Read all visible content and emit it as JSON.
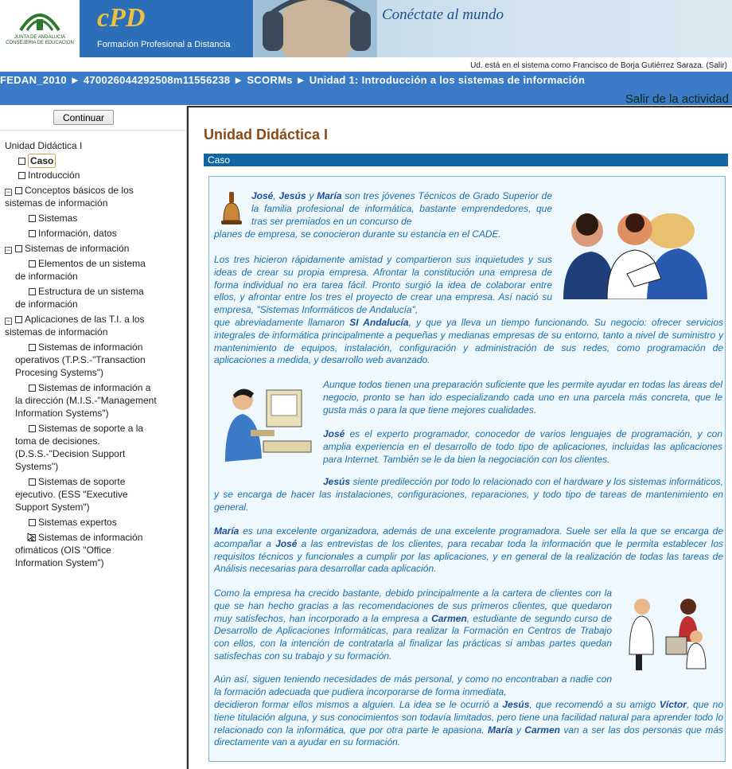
{
  "header": {
    "junta_text": "JUNTA DE ANDALUCIA\nCONSEJERIA DE EDUCACION",
    "cpd_logo": "cPD",
    "cpd_subtitle": "Formación Profesional a Distancia",
    "slogan": "Conéctate al mundo"
  },
  "user_line": {
    "prefix": "Ud. está en el sistema como",
    "user": "Francisco de Borja Gutiérrez Saraza.",
    "logout": "(Salir)"
  },
  "breadcrumb": {
    "items": [
      "FEDAN_2010",
      "470026044292508m11556238",
      "SCORMs",
      "Unidad 1: Introducción a los sistemas de información"
    ],
    "separator": "►"
  },
  "exit_link": "Salir de la actividad",
  "sidebar": {
    "continue_button": "Continuar",
    "root": "Unidad Didáctica I",
    "items": [
      {
        "label": "Caso"
      },
      {
        "label": "Introducción"
      },
      {
        "label": "Conceptos básicos de los",
        "label2": "sistemas de información"
      },
      {
        "label": "Sistemas"
      },
      {
        "label": "Información, datos"
      },
      {
        "label": "Sistemas de información"
      },
      {
        "label": "Elementos de un sistema",
        "label2": "de información"
      },
      {
        "label": "Estructura de un sistema",
        "label2": "de información"
      },
      {
        "label": "Aplicaciones de las T.I. a los",
        "label2": "sistemas de información"
      },
      {
        "label": "Sistemas de información",
        "label2": "operativos (T.P.S.-\"Transaction",
        "label3": "Procesing Systems\")"
      },
      {
        "label": "Sistemas de información a",
        "label2": "la dirección (M.I.S.-\"Management",
        "label3": "Information Systems\")"
      },
      {
        "label": "Sistemas de soporte a la",
        "label2": "toma de decisiones.",
        "label3": "(D.S.S.-\"Decision Support",
        "label4": "Systems\")"
      },
      {
        "label": "Sistemas de soporte",
        "label2": "ejecutivo. (ESS \"Executive",
        "label3": "Support System\")"
      },
      {
        "label": "Sistemas expertos"
      },
      {
        "label": "Sistemas de información",
        "label2": "ofimáticos (OIS \"Office",
        "label3": "Information System\")"
      }
    ]
  },
  "main": {
    "title": "Unidad Didáctica I",
    "section": "Caso"
  },
  "colors": {
    "navbar": "#3a7ac6",
    "section_bar": "#0f66a3",
    "title": "#8a4a18",
    "body_text": "#1a6fb0",
    "content_bg": "#eef8fd"
  }
}
